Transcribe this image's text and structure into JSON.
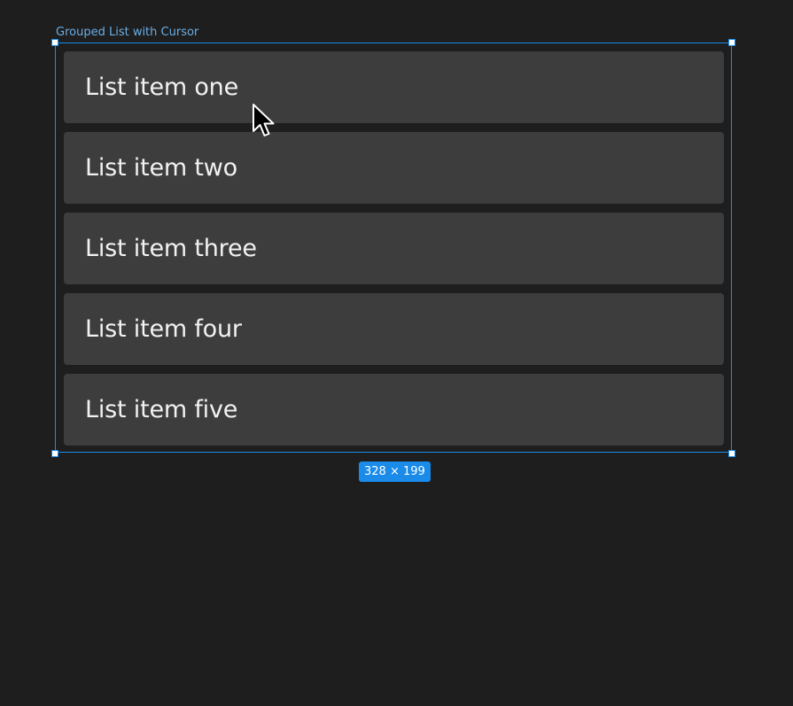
{
  "frame": {
    "label": "Grouped List with Cursor",
    "size_badge": "328 × 199",
    "selection_color": "#1a8be8"
  },
  "list": {
    "items": [
      {
        "label": "List item one"
      },
      {
        "label": "List item two"
      },
      {
        "label": "List item three"
      },
      {
        "label": "List item four"
      },
      {
        "label": "List item five"
      }
    ]
  },
  "cursor": {
    "icon": "pointer-cursor-icon"
  },
  "colors": {
    "canvas_background": "#1e1e1e",
    "item_background": "#3d3d3d",
    "item_text": "#f2f2f2",
    "label_text": "#6aaee6"
  }
}
